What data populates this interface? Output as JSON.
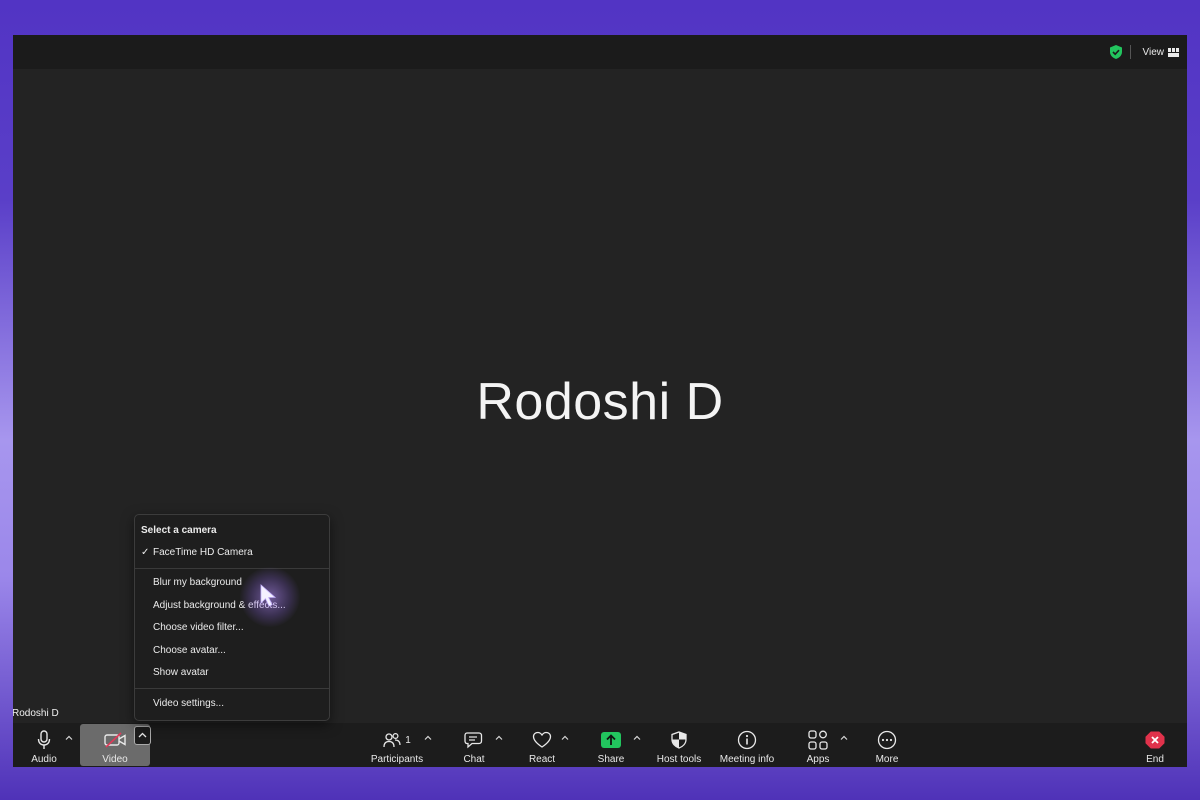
{
  "topbar": {
    "security_icon": "shield-check-icon",
    "view_label": "View",
    "view_icon": "grid-view-icon",
    "security_color": "#22c55e"
  },
  "stage": {
    "participant_name": "Rodoshi D",
    "tile_label": "Rodoshi D"
  },
  "camera_menu": {
    "header": "Select a camera",
    "selected_camera": "FaceTime HD Camera",
    "items": [
      "Blur my background",
      "Adjust background & effects...",
      "Choose video filter...",
      "Choose avatar...",
      "Show avatar"
    ],
    "settings": "Video settings..."
  },
  "toolbar": {
    "audio": {
      "label": "Audio",
      "icon": "microphone-icon"
    },
    "video": {
      "label": "Video",
      "icon": "video-off-icon",
      "active": true,
      "off_color": "#e03a5a"
    },
    "participants": {
      "label": "Participants",
      "icon": "participants-icon",
      "count": "1"
    },
    "chat": {
      "label": "Chat",
      "icon": "chat-icon"
    },
    "react": {
      "label": "React",
      "icon": "heart-icon"
    },
    "share": {
      "label": "Share",
      "icon": "share-screen-icon",
      "color": "#22c55e"
    },
    "host_tools": {
      "label": "Host tools",
      "icon": "shield-icon"
    },
    "meeting_info": {
      "label": "Meeting info",
      "icon": "info-icon"
    },
    "apps": {
      "label": "Apps",
      "icon": "apps-icon"
    },
    "more": {
      "label": "More",
      "icon": "more-icon"
    },
    "end": {
      "label": "End",
      "icon": "end-icon",
      "color": "#e0324b"
    }
  }
}
